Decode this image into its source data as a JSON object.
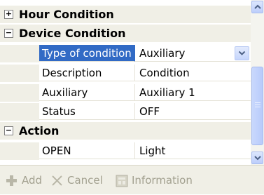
{
  "grid": {
    "categories": [
      {
        "label": "Hour Condition",
        "toggle": "+"
      },
      {
        "label": "Device Condition",
        "toggle": "−"
      },
      {
        "label": "Action",
        "toggle": "−"
      }
    ],
    "device_rows": [
      {
        "name": "Type of condition",
        "value": "Auxiliary"
      },
      {
        "name": "Description",
        "value": "Condition"
      },
      {
        "name": "Auxiliary",
        "value": "Auxiliary 1"
      },
      {
        "name": "Status",
        "value": "OFF"
      }
    ],
    "action_rows": [
      {
        "name": "OPEN",
        "value": "Light"
      }
    ]
  },
  "toolbar": {
    "add_label": "Add",
    "cancel_label": "Cancel",
    "information_label": "Information"
  },
  "colors": {
    "selection": "#316ac5",
    "category_bg": "#f0efe6",
    "disabled_text": "#a3a190"
  }
}
